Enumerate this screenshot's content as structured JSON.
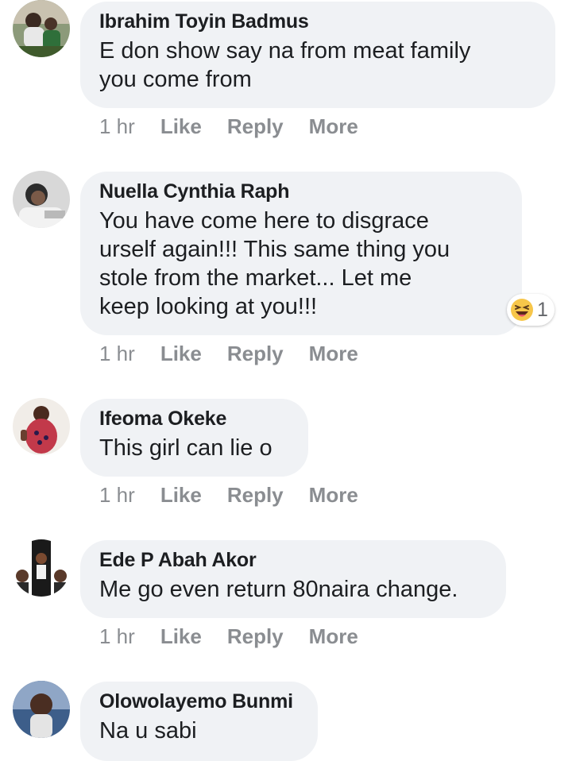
{
  "comments": [
    {
      "author": "Ibrahim Toyin Badmus",
      "text": "E don show say na from meat family\nyou come from",
      "time": "1 hr",
      "like": "Like",
      "reply": "Reply",
      "more": "More"
    },
    {
      "author": "Nuella Cynthia Raph",
      "text": "You have come here to disgrace\nurself again!!! This same thing you\nstole from the market... Let me\nkeep looking at you!!!",
      "time": "1 hr",
      "like": "Like",
      "reply": "Reply",
      "more": "More",
      "reaction": {
        "icon": "laughing-emoji-icon",
        "count": "1"
      }
    },
    {
      "author": "Ifeoma Okeke",
      "text": "This girl can lie o",
      "time": "1 hr",
      "like": "Like",
      "reply": "Reply",
      "more": "More"
    },
    {
      "author": "Ede P Abah Akor",
      "text": "Me go even return 80naira change.",
      "time": "1 hr",
      "like": "Like",
      "reply": "Reply",
      "more": "More"
    },
    {
      "author": "Olowolayemo Bunmi",
      "text": "Na u sabi"
    }
  ],
  "colors": {
    "bubble": "#f0f2f5",
    "meta": "#8a8d91",
    "text": "#1c1e21"
  }
}
